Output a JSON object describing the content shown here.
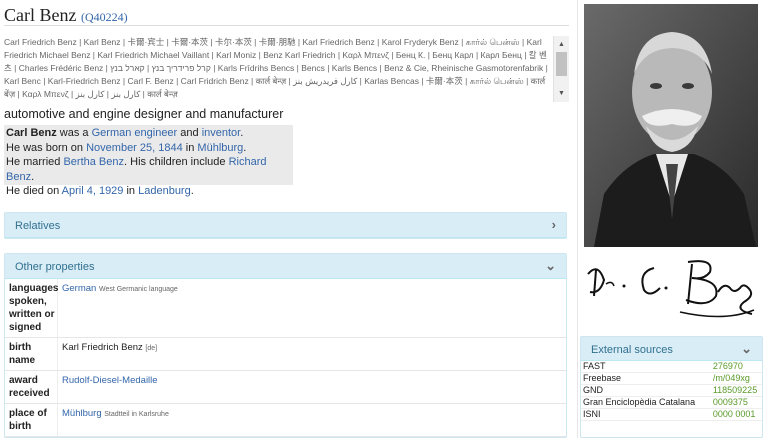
{
  "entity": {
    "label": "Carl Benz",
    "qid": "(Q40224)",
    "description": "automotive and engine designer and manufacturer"
  },
  "aliases_text": "Carl Friedrich Benz | Karl Benz | 卡爾·宾士 | 卡爾·本茨 | 卡尔·本茨 | 卡爾·朋馳 | Karl Friedrich Benz | Karol Fryderyk Benz | கார்ல் பென்ஸ் | Karl Friedrich Michael Benz | Karl Friedrich Michael Vaillant | Karl Moniz | Benz Karl Friedrich | Καρλ Μπενζ | Бенц К. | Бенц Карл | Карл Бенц | 칼 벤츠 | Charles Frédéric Benz | קרל פרידריך בנץ | קארל בנץ | Karls Frīdrihs Bencs | Bencs | Karls Bencs | Benz & Cie, Rheinische Gasmotorenfabrik | Karl Benc | Karl-Friedrich Benz | Carl F. Benz | Carl Fridrich Benz | कार्ल बेन्ज़ | كارل فريدريش بنز | Karlas Bencas | 卡爾·本茨 | கார்ல் பென்ஸ் | कार्ल बेंज़ | Καρλ Μπενζ | كارل بنز | كارل بنز | कार्ल बेन्ज़",
  "summary": {
    "line1": {
      "subject": "Carl Benz",
      "was_a": " was a ",
      "occ1": "German engineer",
      "and": " and ",
      "occ2": "inventor",
      "end": "."
    },
    "line2": {
      "pre": "He was born on ",
      "date": "November 25, 1844",
      "in": " in ",
      "place": "Mühlburg",
      "end": "."
    },
    "line3": {
      "pre": "He married ",
      "spouse": "Bertha Benz",
      "mid": ". His children include ",
      "child": "Richard Benz",
      "end": "."
    },
    "line4": {
      "pre": "He died on ",
      "date": "April 4, 1929",
      "in": " in ",
      "place": "Ladenburg",
      "end": "."
    }
  },
  "relatives_panel": {
    "title": "Relatives",
    "chevron": "›"
  },
  "other_panel": {
    "title": "Other properties",
    "chevron": "⌄",
    "rows": [
      {
        "label": "languages spoken, written or signed",
        "value": "German",
        "qualifier": "West Germanic language"
      },
      {
        "label": "birth name",
        "value": "Karl Friedrich Benz",
        "qualifier": "[de]"
      },
      {
        "label": "award received",
        "value": "Rudolf-Diesel-Medaille",
        "qualifier": ""
      },
      {
        "label": "place of birth",
        "value": "Mühlburg",
        "qualifier": "Stadtteil in Karlsruhe"
      }
    ]
  },
  "external_sources": {
    "title": "External sources",
    "chevron": "⌄",
    "rows": [
      {
        "name": "FAST",
        "value": "276970"
      },
      {
        "name": "Freebase",
        "value": "/m/049xg"
      },
      {
        "name": "GND",
        "value": "118509225"
      },
      {
        "name": "Gran Enciclopèdia Catalana",
        "value": "0009375"
      },
      {
        "name": "ISNI",
        "value": "0000 0001"
      }
    ]
  },
  "signature_text": "Dr. C. Benz",
  "colors": {
    "link": "#3366aa",
    "panel_head": "#d9edf7",
    "panel_title": "#31708f",
    "ext_value": "#5a9a2a",
    "summary_bg": "#eaeaea"
  }
}
